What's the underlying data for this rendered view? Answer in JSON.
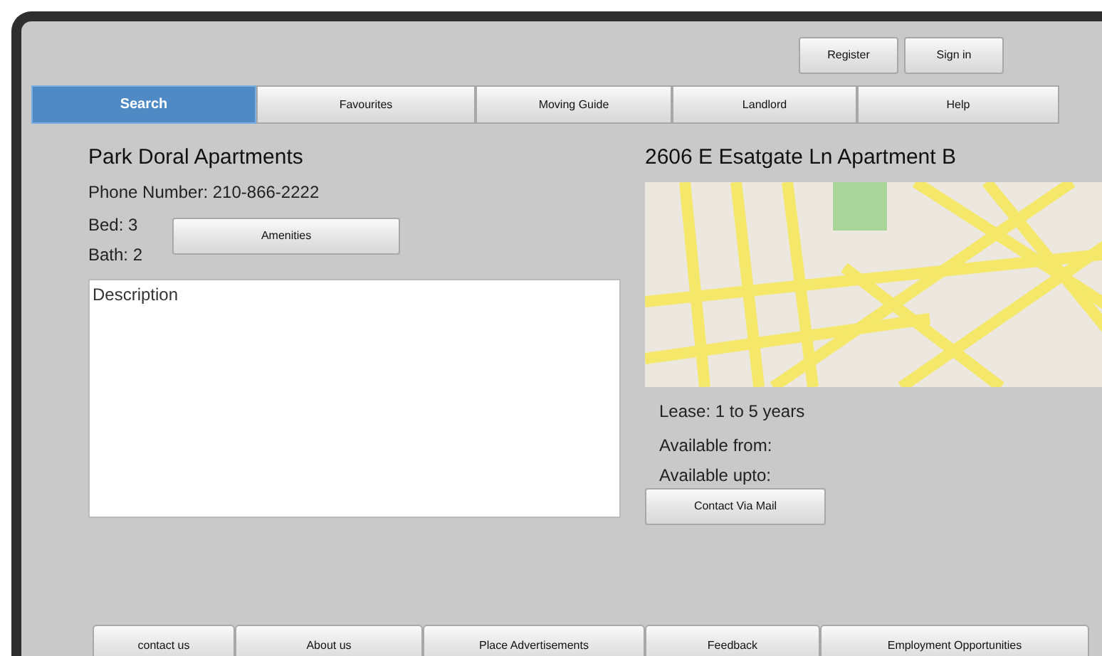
{
  "header_buttons": [
    "Register",
    "Sign in"
  ],
  "tabs": [
    {
      "label": "Search",
      "selected": true
    },
    {
      "label": "Favourites",
      "selected": false
    },
    {
      "label": "Moving Guide",
      "selected": false
    },
    {
      "label": "Landlord",
      "selected": false
    },
    {
      "label": "Help",
      "selected": false
    }
  ],
  "listing": {
    "name": "Park Doral Apartments",
    "phone": "Phone Number: 210-866-2222",
    "bed": "Bed: 3",
    "bath": "Bath: 2",
    "amenities_button": "Amenities",
    "description": "Description"
  },
  "details": {
    "address": "2606 E Esatgate Ln Apartment B",
    "lease": "Lease: 1 to 5 years",
    "available_from": "Available from:",
    "available_upto": "Available upto:",
    "contact_button": "Contact Via Mail"
  },
  "footer_links": [
    "contact us",
    "About us",
    "Place Advertisements",
    "Feedback",
    "Employment Opportunities"
  ]
}
